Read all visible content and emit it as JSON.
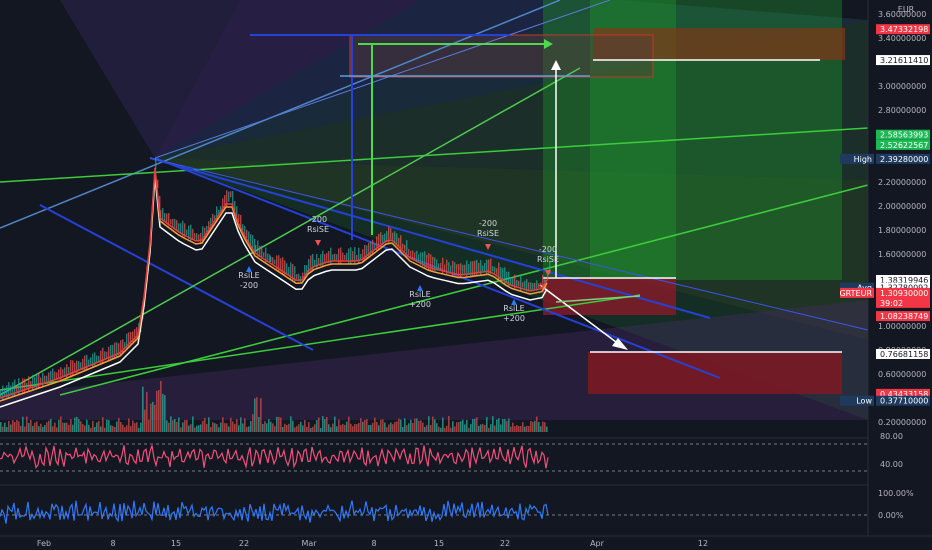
{
  "currency": "EUR",
  "price_axis": {
    "ticks": [
      "3.60000000",
      "3.40000000",
      "3.20000000",
      "3.00000000",
      "2.80000000",
      "2.60000000",
      "2.40000000",
      "2.20000000",
      "2.00000000",
      "1.80000000",
      "1.60000000",
      "1.40000000",
      "1.20000000",
      "1.00000000",
      "0.80000000",
      "0.60000000",
      "0.40000000",
      "0.20000000"
    ],
    "tags": [
      {
        "label": "",
        "value": "3.47332198",
        "color": "#f23645"
      },
      {
        "label": "",
        "value": "3.21611410",
        "color": "#ffffff"
      },
      {
        "label": "",
        "value": "2.58563993",
        "color": "#1db954"
      },
      {
        "label": "",
        "value": "2.52622567",
        "color": "#1db954"
      },
      {
        "label": "High",
        "value": "2.39280000",
        "color": "#1e3a5f"
      },
      {
        "label": "",
        "value": "1.38319946",
        "color": "#ffffff"
      },
      {
        "label": "Avg",
        "value": "1.32780092",
        "color": "#ffffff"
      },
      {
        "label": "GRTEUR",
        "value": "1.30930000",
        "sub": "39:02",
        "color": "#f23645"
      },
      {
        "label": "",
        "value": "1.08238749",
        "color": "#f23645"
      },
      {
        "label": "",
        "value": "0.76681158",
        "color": "#ffffff"
      },
      {
        "label": "",
        "value": "0.43433158",
        "color": "#f23645"
      },
      {
        "label": "Low",
        "value": "0.37710000",
        "color": "#1e3a5f"
      }
    ]
  },
  "rsi_axis": {
    "ticks": [
      "80.00",
      "40.00"
    ]
  },
  "osc_axis": {
    "ticks": [
      "100.00%",
      "0.00%"
    ]
  },
  "time_axis": {
    "ticks": [
      "Feb",
      "8",
      "15",
      "22",
      "Mar",
      "8",
      "15",
      "22",
      "Apr",
      "12"
    ]
  },
  "signals": [
    {
      "text": "-200\nRsiSE",
      "kind": "short"
    },
    {
      "text": "RsiLE\n-200",
      "kind": "long"
    },
    {
      "text": "-200\nRsiSE",
      "kind": "short"
    },
    {
      "text": "RsiLE\n+200",
      "kind": "long"
    },
    {
      "text": "-200\nRsiSE",
      "kind": "short"
    },
    {
      "text": "RsiLE\n+200",
      "kind": "long"
    }
  ],
  "colors": {
    "bg": "#131722",
    "up": "#26a69a",
    "down": "#ef5350",
    "rsi": "#f0507a",
    "osc": "#3179f5"
  }
}
